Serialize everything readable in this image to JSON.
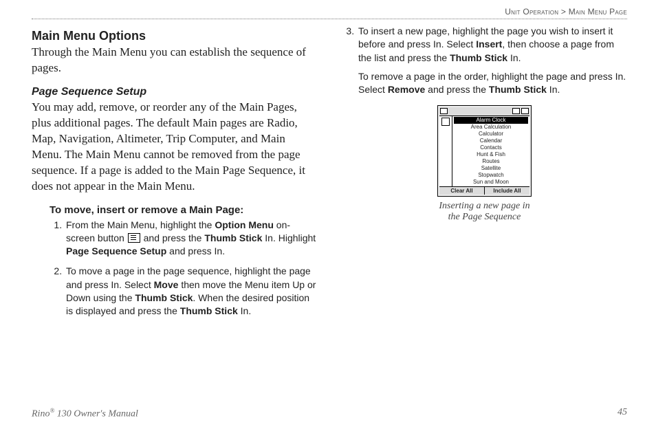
{
  "breadcrumb": {
    "section": "Unit Operation",
    "sep": ">",
    "page": "Main Menu Page"
  },
  "heading": "Main Menu Options",
  "intro": "Through the Main Menu you can establish the sequence of pages.",
  "sub": {
    "title": "Page Sequence Setup",
    "body": "You may add, remove, or reorder any of the Main Pages, plus additional pages. The default Main pages are Radio, Map, Navigation, Altimeter, Trip Computer, and Main Menu. The Main Menu cannot be removed from the page sequence. If a page is added to the Main Page Sequence, it does not appear in the Main Menu."
  },
  "procedure": {
    "title": "To move, insert or remove a Main Page:",
    "steps_left": [
      {
        "pre": "From the Main Menu, highlight the ",
        "b1": "Option Menu",
        "mid1": " on-screen button ",
        "mid2": " and press the ",
        "b2": "Thumb Stick",
        "mid3": " In. Highlight ",
        "b3": "Page Sequence Setup",
        "post": " and press In."
      },
      {
        "pre": "To move a page in the page sequence, highlight the page and press In. Select ",
        "b1": "Move",
        "mid1": " then move the Menu item Up or Down using the ",
        "b2": "Thumb Stick",
        "mid2": ". When the desired position is displayed and press the ",
        "b3": "Thumb Stick",
        "post": " In."
      }
    ],
    "steps_right": [
      {
        "pre": "To insert a new page, highlight the page you wish to insert it before and press In. Select ",
        "b1": "Insert",
        "mid1": ", then choose a page from the list and press the ",
        "b2": "Thumb Stick",
        "post": " In."
      }
    ],
    "note_right": {
      "pre": "To remove a page in the order, highlight the page and press In. Select ",
      "b1": "Remove",
      "mid": " and press the ",
      "b2": "Thumb Stick",
      "post": " In."
    }
  },
  "figure": {
    "titlebar": "",
    "list": [
      "Alarm Clock",
      "Area Calculation",
      "Calculator",
      "Calendar",
      "Contacts",
      "Hunt & Fish",
      "Routes",
      "Satellite",
      "Stopwatch",
      "Sun and Moon"
    ],
    "highlight_index": 0,
    "buttons": {
      "left": "Clear All",
      "right": "Include All"
    },
    "caption_l1": "Inserting a new page in",
    "caption_l2": "the Page Sequence"
  },
  "footer": {
    "product_pre": "Rino",
    "reg": "®",
    "product_post": " 130 Owner's Manual",
    "pagenum": "45"
  }
}
